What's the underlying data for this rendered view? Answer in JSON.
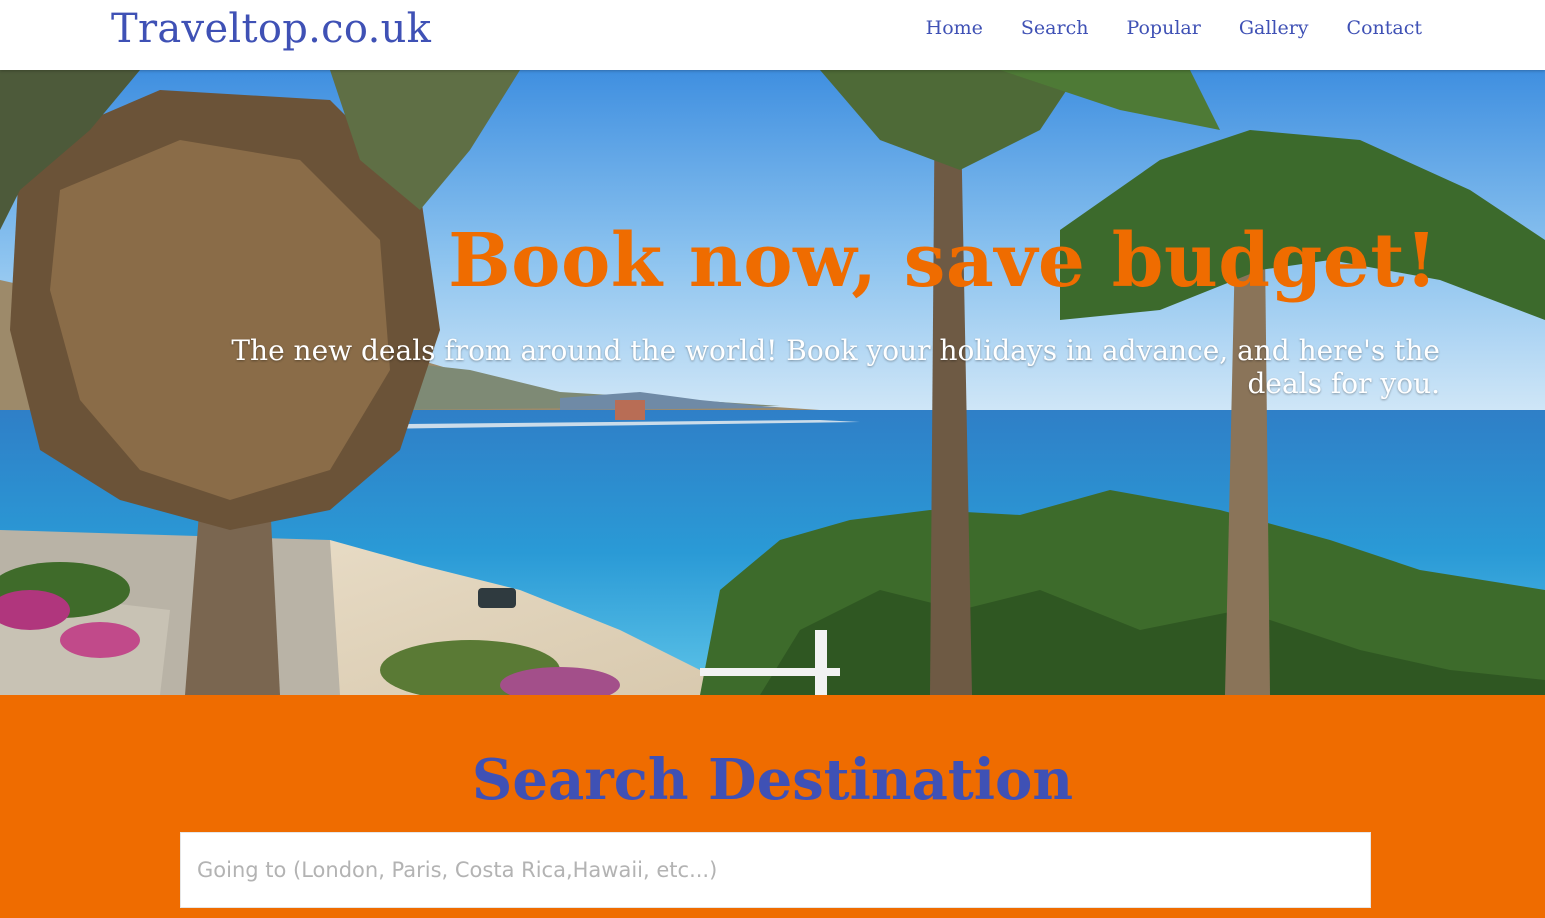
{
  "header": {
    "brand": "Traveltop.co.uk",
    "nav": [
      "Home",
      "Search",
      "Popular",
      "Gallery",
      "Contact"
    ]
  },
  "hero": {
    "title": "Book now, save budget!",
    "subtitle": "The new deals from around the world! Book your holidays in advance, and here's the deals for you."
  },
  "search": {
    "title": "Search Destination",
    "placeholder": "Going to (London, Paris, Costa Rica,Hawaii, etc...)",
    "value": ""
  },
  "colors": {
    "accent": "#ef6c00",
    "brand": "#3f51b5"
  }
}
